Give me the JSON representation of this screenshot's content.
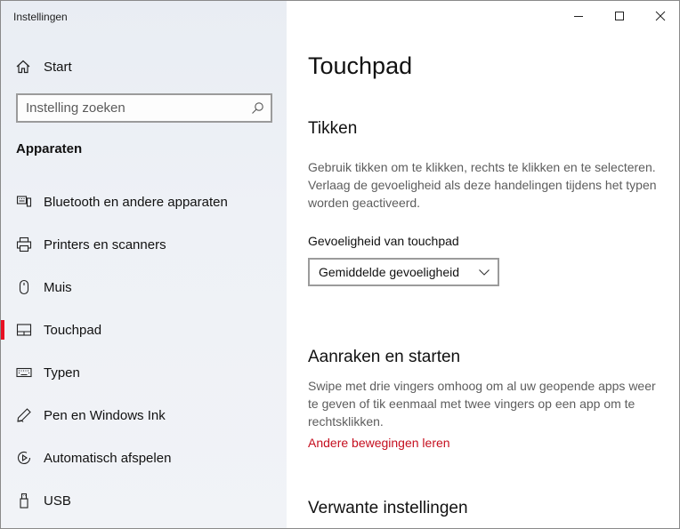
{
  "window": {
    "app_title": "Instellingen"
  },
  "sidebar": {
    "start_label": "Start",
    "search": {
      "placeholder": "Instelling zoeken",
      "value": ""
    },
    "section_heading": "Apparaten",
    "items": [
      {
        "label": "Bluetooth en andere apparaten",
        "icon": "bluetooth-devices-icon",
        "active": false
      },
      {
        "label": "Printers en scanners",
        "icon": "printer-icon",
        "active": false
      },
      {
        "label": "Muis",
        "icon": "mouse-icon",
        "active": false
      },
      {
        "label": "Touchpad",
        "icon": "touchpad-icon",
        "active": true
      },
      {
        "label": "Typen",
        "icon": "keyboard-icon",
        "active": false
      },
      {
        "label": "Pen en Windows Ink",
        "icon": "pen-icon",
        "active": false
      },
      {
        "label": "Automatisch afspelen",
        "icon": "autoplay-icon",
        "active": false
      },
      {
        "label": "USB",
        "icon": "usb-icon",
        "active": false
      }
    ]
  },
  "main": {
    "page_title": "Touchpad",
    "tikken": {
      "heading": "Tikken",
      "description": "Gebruik tikken om te klikken, rechts te klikken en te selecteren. Verlaag de gevoeligheid als deze handelingen tijdens het typen worden geactiveerd.",
      "sensitivity_label": "Gevoeligheid van touchpad",
      "sensitivity_value": "Gemiddelde gevoeligheid"
    },
    "aanraken": {
      "heading": "Aanraken en starten",
      "description": "Swipe met drie vingers omhoog om al uw geopende apps weer te geven of tik eenmaal met twee vingers op een app om te rechtsklikken.",
      "link": "Andere bewegingen leren"
    },
    "related": {
      "heading": "Verwante instellingen"
    }
  },
  "colors": {
    "accent": "#e81123",
    "link": "#c50f1f",
    "sidebar_bg": "#eef1f6"
  }
}
